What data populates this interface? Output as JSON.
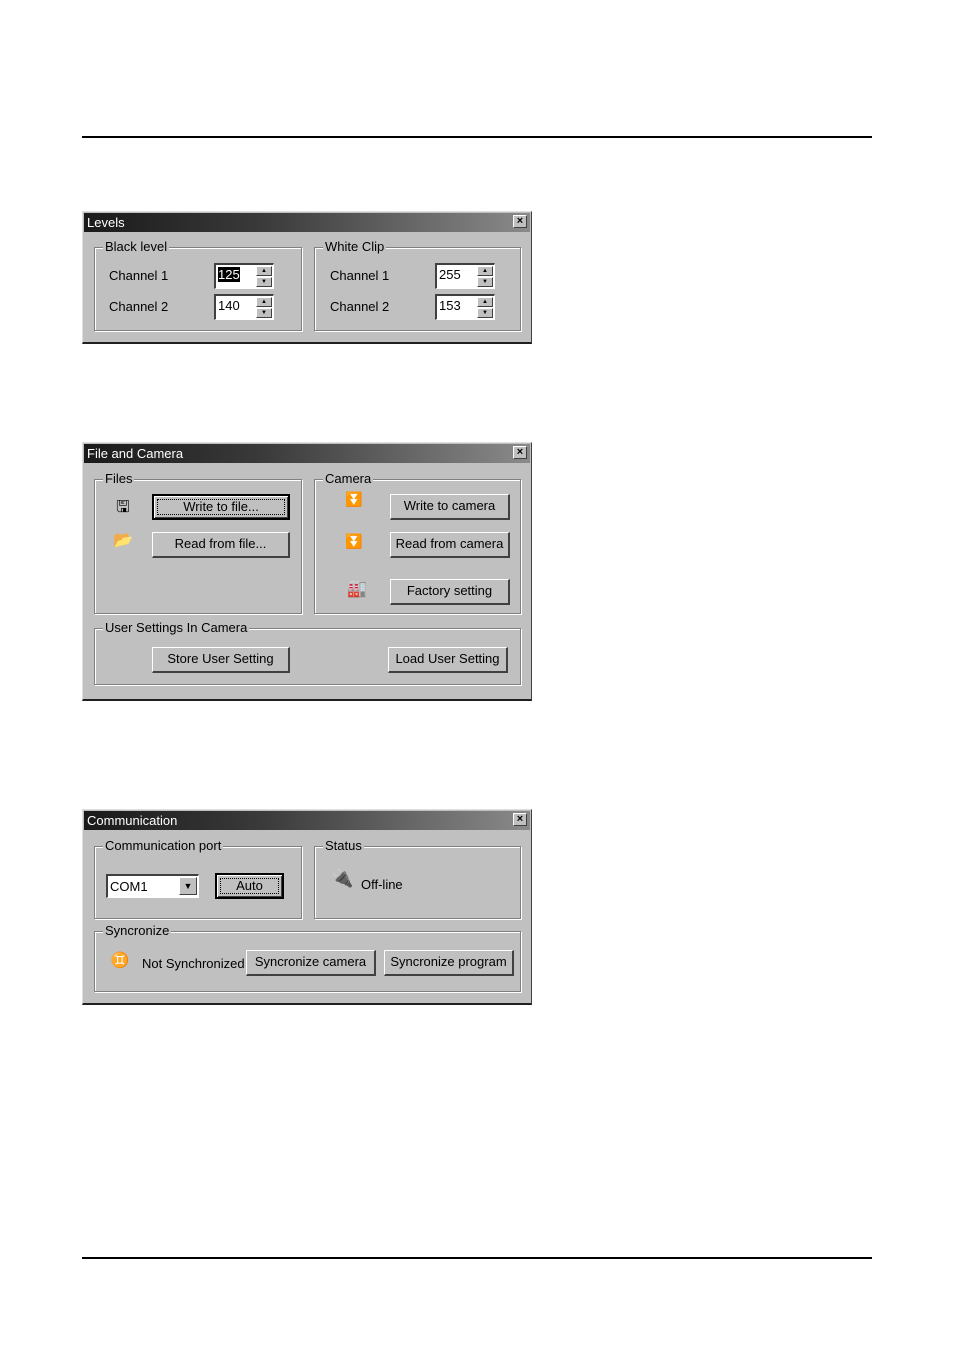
{
  "levels": {
    "title": "Levels",
    "close_icon": "×",
    "black_level": {
      "label": "Black level",
      "channel1": {
        "label": "Channel 1",
        "value": "125"
      },
      "channel2": {
        "label": "Channel 2",
        "value": "140"
      }
    },
    "white_clip": {
      "label": "White Clip",
      "channel1": {
        "label": "Channel 1",
        "value": "255"
      },
      "channel2": {
        "label": "Channel 2",
        "value": "153"
      }
    },
    "spin_up": "▲",
    "spin_down": "▼"
  },
  "file_camera": {
    "title": "File and Camera",
    "close_icon": "×",
    "files": {
      "label": "Files",
      "save_icon": "🖫",
      "open_icon": "📂",
      "write_button": "Write to file...",
      "read_button": "Read from file..."
    },
    "camera": {
      "label": "Camera",
      "write_icon": "⏬",
      "read_icon": "⏬",
      "factory_icon": "🏭",
      "write_button": "Write to camera",
      "read_button": "Read from camera",
      "factory_button": "Factory setting"
    },
    "user_settings": {
      "label": "User Settings In Camera",
      "store_button": "Store User Setting",
      "load_button": "Load User Setting"
    }
  },
  "communication": {
    "title": "Communication",
    "close_icon": "×",
    "port": {
      "label": "Communication port",
      "selected": "COM1",
      "dropdown_icon": "▼",
      "auto_button": "Auto"
    },
    "status": {
      "label": "Status",
      "plug_icon": "🔌",
      "text": "Off-line"
    },
    "sync": {
      "label": "Syncronize",
      "people_icon": "♊",
      "text": "Not Synchronized",
      "camera_button": "Syncronize camera",
      "program_button": "Syncronize program"
    }
  }
}
